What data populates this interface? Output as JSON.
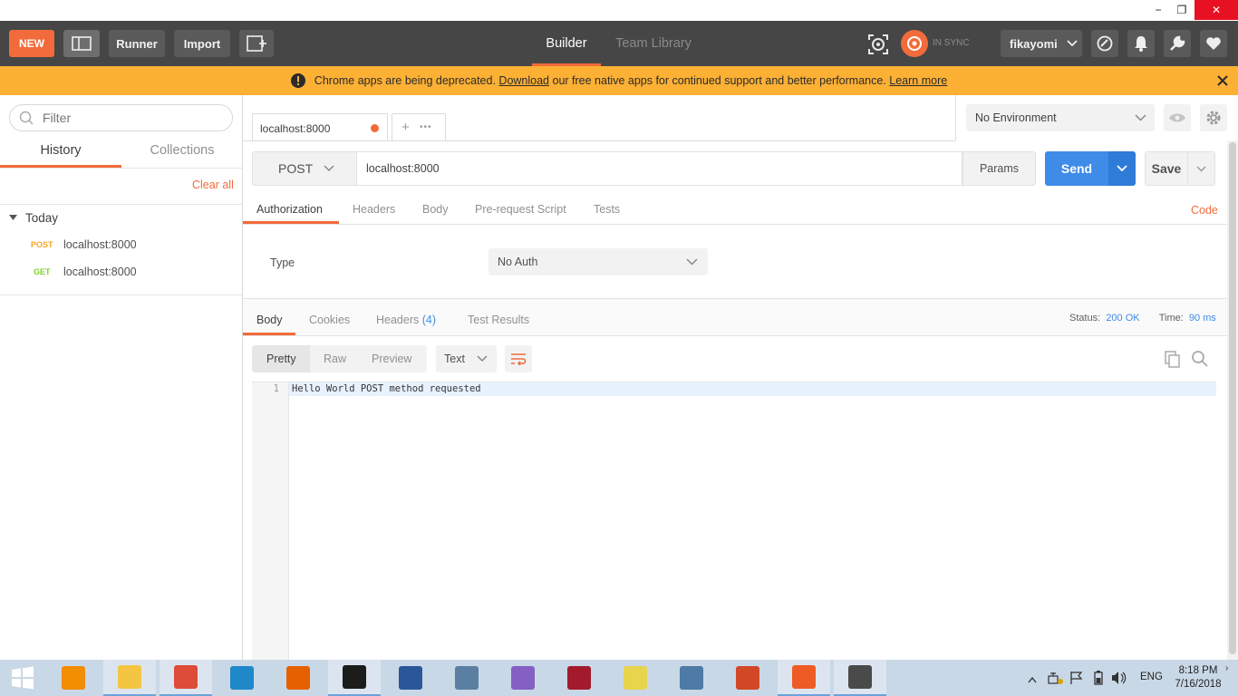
{
  "window": {
    "minimize": "−",
    "restore": "❐",
    "close": "✕"
  },
  "header": {
    "new_label": "NEW",
    "runner_label": "Runner",
    "import_label": "Import",
    "builder_label": "Builder",
    "team_library_label": "Team Library",
    "sync_label": "IN SYNC",
    "user_label": "fikayomi"
  },
  "banner": {
    "text_before": "Chrome apps are being deprecated. ",
    "download_link": "Download",
    "text_after": " our free native apps for continued support and better performance. ",
    "learn_more_link": "Learn more"
  },
  "sidebar": {
    "filter_placeholder": "Filter",
    "tab_history": "History",
    "tab_collections": "Collections",
    "clear_all": "Clear all",
    "group_label": "Today",
    "items": [
      {
        "method": "POST",
        "url": "localhost:8000",
        "method_color": "#f5a623"
      },
      {
        "method": "GET",
        "url": "localhost:8000",
        "method_color": "#7ed321"
      }
    ]
  },
  "request_tab": {
    "label": "localhost:8000",
    "add": "+",
    "more": "•••"
  },
  "environment": {
    "selected": "No Environment"
  },
  "request": {
    "method": "POST",
    "url": "localhost:8000",
    "params_label": "Params",
    "send_label": "Send",
    "save_label": "Save"
  },
  "request_tabs": {
    "authorization": "Authorization",
    "headers": "Headers",
    "body": "Body",
    "pre_request": "Pre-request Script",
    "tests": "Tests",
    "code": "Code"
  },
  "auth": {
    "type_label": "Type",
    "type_value": "No Auth"
  },
  "response_tabs": {
    "body": "Body",
    "cookies": "Cookies",
    "headers": "Headers",
    "headers_count": "(4)",
    "test_results": "Test Results",
    "status_label": "Status:",
    "status_value": "200 OK",
    "time_label": "Time:",
    "time_value": "90 ms"
  },
  "response_view": {
    "pretty": "Pretty",
    "raw": "Raw",
    "preview": "Preview",
    "format": "Text"
  },
  "editor": {
    "line_number": "1",
    "content": "Hello World POST method requested"
  },
  "colors": {
    "accent": "#f26b3a",
    "send_blue": "#3f8ce8",
    "banner": "#fcb034",
    "header": "#464646",
    "link_blue": "#3f8ce8"
  },
  "taskbar": {
    "lang": "ENG",
    "time": "8:18 PM",
    "date": "7/16/2018",
    "apps": [
      {
        "name": "vlc-icon",
        "color": "#f28c00"
      },
      {
        "name": "file-explorer-icon",
        "color": "#f4c542"
      },
      {
        "name": "chrome-icon",
        "color": "#dd4b39"
      },
      {
        "name": "app-blue-icon",
        "color": "#1e88c9"
      },
      {
        "name": "firefox-icon",
        "color": "#e66000"
      },
      {
        "name": "cmd-icon",
        "color": "#1c1c1c"
      },
      {
        "name": "word-icon",
        "color": "#2b579a"
      },
      {
        "name": "notepad-icon",
        "color": "#5a7fa3"
      },
      {
        "name": "visual-studio-icon",
        "color": "#865fc5"
      },
      {
        "name": "mendeley-icon",
        "color": "#a31a2d"
      },
      {
        "name": "sticky-notes-icon",
        "color": "#e8d44d"
      },
      {
        "name": "document-icon",
        "color": "#4d7aa6"
      },
      {
        "name": "powerpoint-icon",
        "color": "#d24726"
      },
      {
        "name": "postman-icon",
        "color": "#ef5b25"
      },
      {
        "name": "sublime-icon",
        "color": "#4a4a4a"
      }
    ]
  }
}
